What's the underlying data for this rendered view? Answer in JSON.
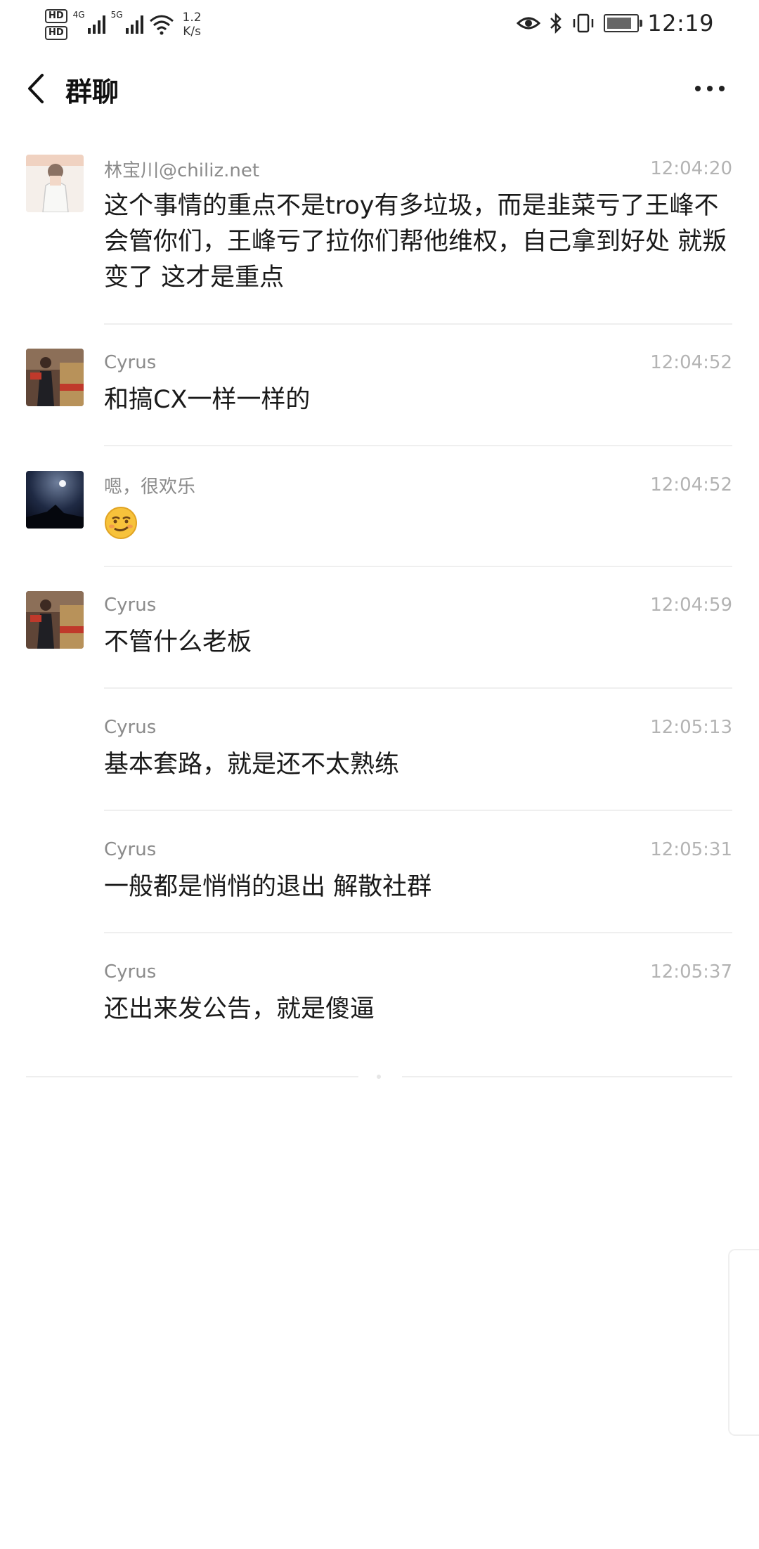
{
  "status_bar": {
    "hd_1": "HD",
    "hd_2": "HD",
    "net_1": "4G",
    "net_2": "5G",
    "speed_value": "1.2",
    "speed_unit": "K/s",
    "time": "12:19"
  },
  "header": {
    "title": "群聊"
  },
  "messages": [
    {
      "sender": "林宝川@chiliz.net",
      "time": "12:04:20",
      "text": "这个事情的重点不是troy有多垃圾，而是韭菜亏了王峰不会管你们，王峰亏了拉你们帮他维权，自己拿到好处 就叛变了 这才是重点"
    },
    {
      "sender": "Cyrus",
      "time": "12:04:52",
      "text": "和搞CX一样一样的"
    },
    {
      "sender": "嗯，很欢乐",
      "time": "12:04:52",
      "text": ""
    },
    {
      "sender": "Cyrus",
      "time": "12:04:59",
      "text": "不管什么老板"
    },
    {
      "sender": "Cyrus",
      "time": "12:05:13",
      "text": "基本套路，就是还不太熟练"
    },
    {
      "sender": "Cyrus",
      "time": "12:05:31",
      "text": "一般都是悄悄的退出 解散社群"
    },
    {
      "sender": "Cyrus",
      "time": "12:05:37",
      "text": "还出来发公告，就是傻逼"
    }
  ]
}
